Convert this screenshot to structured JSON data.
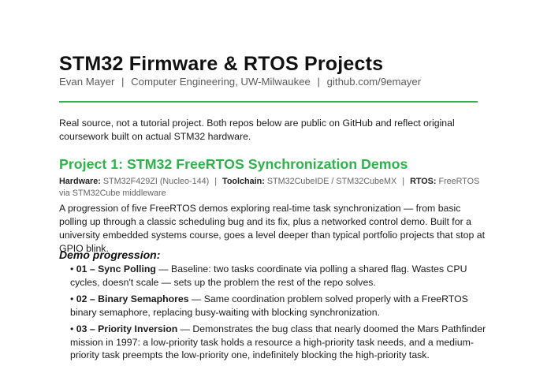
{
  "header": {
    "title": "STM32 Firmware & RTOS Projects",
    "author": "Evan Mayer",
    "affiliation": "Computer Engineering, UW-Milwaukee",
    "link": "github.com/9emayer",
    "separator": "|"
  },
  "colors": {
    "accent": "#2fb24c",
    "text": "#111111",
    "muted": "#666666"
  },
  "intro": "Real source, not a tutorial project. Both repos below are public on GitHub and reflect original coursework built on actual STM32 hardware.",
  "project1": {
    "heading": "Project 1: STM32 FreeRTOS Synchronization Demos",
    "meta": [
      {
        "label": "Hardware:",
        "value": "STM32F429ZI (Nucleo-144)"
      },
      {
        "label": "Toolchain:",
        "value": "STM32CubeIDE / STM32CubeMX"
      },
      {
        "label": "RTOS:",
        "value": "FreeRTOS via STM32Cube middleware"
      }
    ],
    "description": "A progression of five FreeRTOS demos exploring real-time task synchronization — from basic polling up through a classic scheduling bug and its fix, plus a networked control demo. Built for a university embedded systems course, goes a level deeper than typical portfolio projects that stop at GPIO blink.",
    "demo_heading": "Demo progression:",
    "demos": [
      {
        "bullet": "•",
        "name": "01 – Sync Polling",
        "text": " — Baseline: two tasks coordinate via polling a shared flag. Wastes CPU cycles, doesn't scale — sets up the problem the rest of the repo solves."
      },
      {
        "bullet": "•",
        "name": "02 – Binary Semaphores",
        "text": " — Same coordination problem solved properly with a FreeRTOS binary semaphore, replacing busy-waiting with blocking synchronization."
      },
      {
        "bullet": "•",
        "name": "03 – Priority Inversion",
        "text": " — Demonstrates the bug class that nearly doomed the Mars Pathfinder mission in 1997: a low-priority task holds a resource a high-priority task needs, and a medium-priority task preempts the low-priority one, indefinitely blocking the high-priority task."
      }
    ]
  }
}
